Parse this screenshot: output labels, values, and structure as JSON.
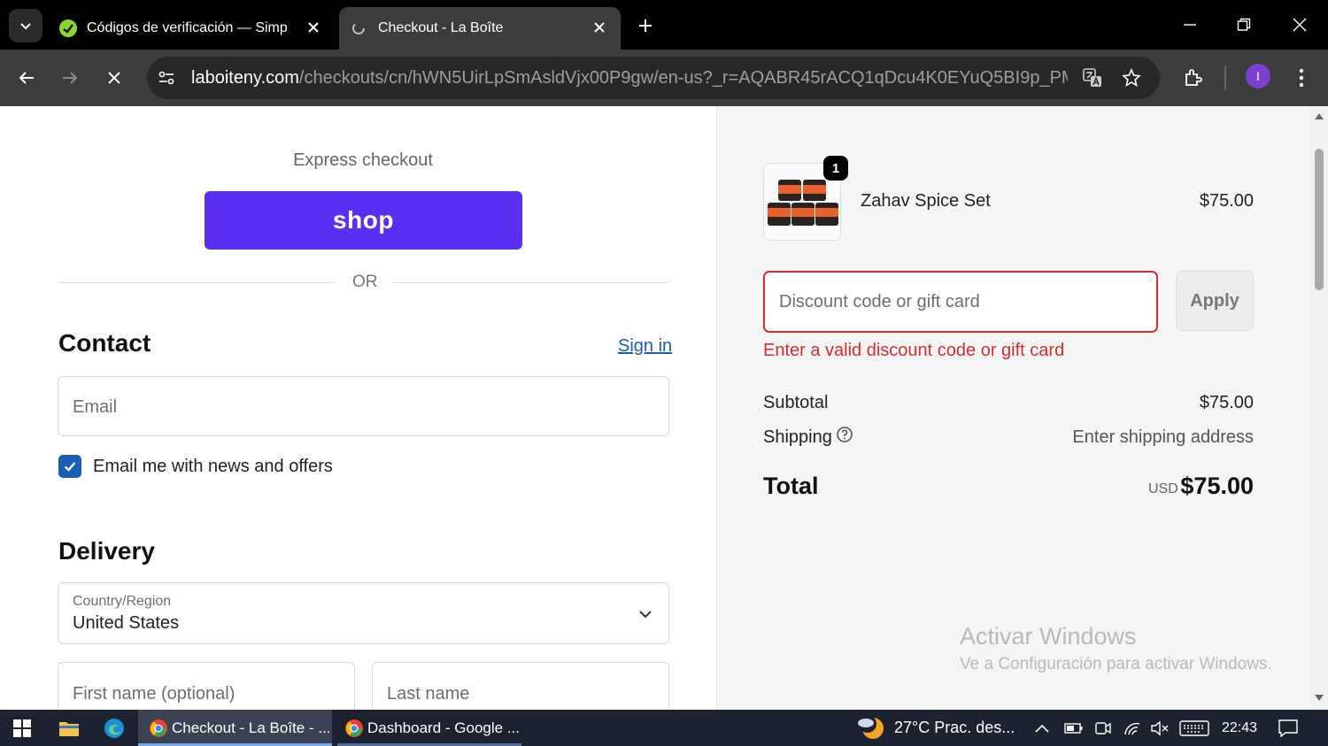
{
  "browser": {
    "tabs": [
      {
        "title": "Códigos de verificación — Simp",
        "active": false
      },
      {
        "title": "Checkout - La Boîte",
        "active": true
      }
    ],
    "url_host": "laboiteny.com",
    "url_path": "/checkouts/cn/hWN5UirLpSmAsldVjx00P9gw/en-us?_r=AQABR45rACQ1qDcu4K0EYuQ5BI9p_PMsdX...",
    "profile_initial": "I"
  },
  "checkout": {
    "express_label": "Express checkout",
    "shop_button": "shop",
    "or_label": "OR",
    "contact": {
      "heading": "Contact",
      "sign_in": "Sign in",
      "email_placeholder": "Email",
      "newsletter_label": "Email me with news and offers"
    },
    "delivery": {
      "heading": "Delivery",
      "country_label": "Country/Region",
      "country_value": "United States",
      "first_name_placeholder": "First name (optional)",
      "last_name_placeholder": "Last name"
    }
  },
  "summary": {
    "item": {
      "name": "Zahav Spice Set",
      "price": "$75.00",
      "quantity": "1"
    },
    "discount_placeholder": "Discount code or gift card",
    "apply_label": "Apply",
    "discount_error": "Enter a valid discount code or gift card",
    "subtotal_label": "Subtotal",
    "subtotal_value": "$75.00",
    "shipping_label": "Shipping",
    "shipping_value": "Enter shipping address",
    "total_label": "Total",
    "total_currency": "USD",
    "total_value": "$75.00"
  },
  "watermark": {
    "title": "Activar Windows",
    "subtitle": "Ve a Configuración para activar Windows."
  },
  "taskbar": {
    "apps": [
      {
        "label": "Checkout - La Boîte - ...",
        "active": true
      },
      {
        "label": "Dashboard - Google ...",
        "active": false
      }
    ],
    "weather": "27°C  Prac. des...",
    "time": "22:43"
  },
  "colors": {
    "shop_purple": "#5a31f4",
    "link_blue": "#1a5fb4",
    "error_red": "#d82c2c"
  }
}
